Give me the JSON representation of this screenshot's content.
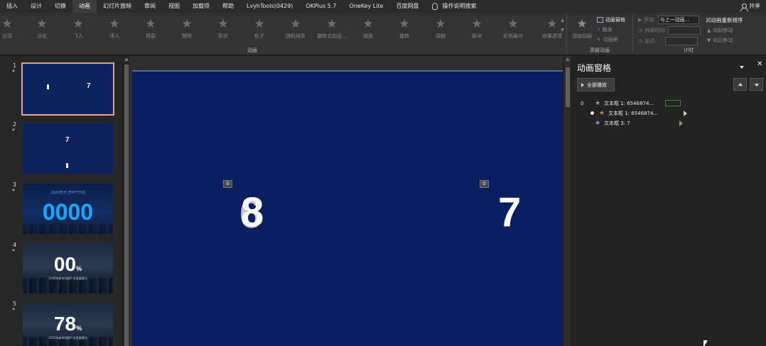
{
  "menubar": {
    "tabs": [
      "插入",
      "设计",
      "切换",
      "动画",
      "幻灯片放映",
      "审阅",
      "视图",
      "加载项",
      "帮助",
      "LvyhTools(0429)",
      "OKPlus 5.7",
      "OneKey Lite",
      "百度网盘"
    ],
    "active_tab": "动画",
    "search_label": "操作说明搜索",
    "share_label": "共享"
  },
  "ribbon": {
    "animations": [
      "出现",
      "淡化",
      "飞入",
      "浮入",
      "劈裂",
      "擦除",
      "形状",
      "轮子",
      "随机线条",
      "翻转式由远...",
      "缩放",
      "旋转",
      "弹跳",
      "脉冲",
      "彩色脉冲",
      "效果选项"
    ],
    "group_animation": "动画",
    "advanced": {
      "add_animation": "添加动画",
      "animation_pane": "动画窗格",
      "trigger": "触发",
      "animation_painter": "动画刷",
      "group_label": "高级动画"
    },
    "timing": {
      "start_label": "开始:",
      "start_value": "与上一动画...",
      "duration_label": "持续时间:",
      "delay_label": "延迟:",
      "group_label": "计时"
    },
    "reorder": {
      "title": "对动画重新排序",
      "move_earlier": "向前移动",
      "move_later": "向后移动"
    }
  },
  "thumbnails": [
    {
      "num": "1",
      "digit": "7"
    },
    {
      "num": "2",
      "digit": "7"
    },
    {
      "num": "3",
      "title": "2020年元 开PPT方向",
      "digits": "0000"
    },
    {
      "num": "4",
      "digits": "00",
      "unit": "%",
      "caption": "2020年新市场国产业发展情况"
    },
    {
      "num": "5",
      "digits": "78",
      "unit": "%",
      "caption": "2020年新市场国产业发展情况"
    }
  ],
  "slide": {
    "tag_left": "0",
    "tag_right": "0",
    "number_left": "8",
    "number_right": "7"
  },
  "animation_pane": {
    "title": "动画窗格",
    "play_all": "全部播放",
    "rows": [
      {
        "index": "0",
        "label": "文本框 1: 6546874..."
      },
      {
        "index": "",
        "label": "文本框 1: 6546874..."
      },
      {
        "index": "",
        "label": "文本框 3: 7"
      }
    ]
  },
  "colors": {
    "slide_bg": "#0b1f60",
    "selected_thumb_border": "#e8a37f",
    "accent_blue": "#1aa7ff",
    "orange_star": "#e07b39"
  }
}
